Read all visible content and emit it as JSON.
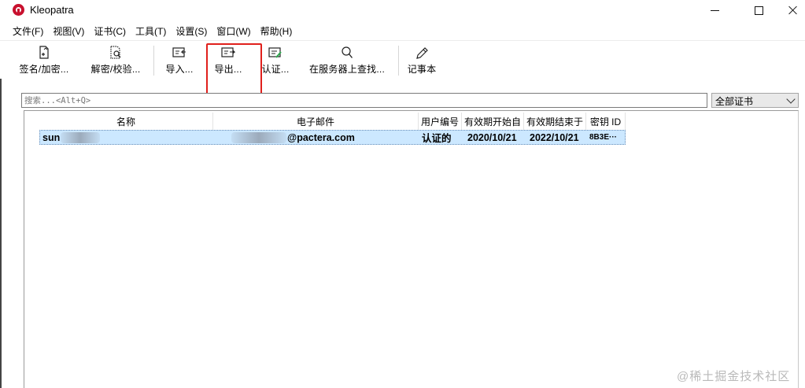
{
  "window": {
    "title": "Kleopatra"
  },
  "menu": [
    "文件(F)",
    "视图(V)",
    "证书(C)",
    "工具(T)",
    "设置(S)",
    "窗口(W)",
    "帮助(H)"
  ],
  "toolbar": {
    "sign_encrypt": "签名/加密...",
    "decrypt_verify": "解密/校验...",
    "import": "导入...",
    "export": "导出...",
    "certify": "认证...",
    "lookup_server": "在服务器上查找...",
    "notepad": "记事本"
  },
  "search": {
    "placeholder": "搜索...<Alt+Q>",
    "value": ""
  },
  "filter": {
    "selected": "全部证书"
  },
  "table": {
    "headers": [
      "名称",
      "电子邮件",
      "用户编号",
      "有效期开始自",
      "有效期结束于",
      "密钥 ID"
    ],
    "rows": [
      {
        "name": "sun",
        "email": "@pactera.com",
        "user_id": "认证的",
        "valid_from": "2020/10/21",
        "valid_until": "2022/10/21",
        "key_id": "8B3E···"
      }
    ]
  },
  "watermark": "@稀土掘金技术社区",
  "colors": {
    "selection": "#cce8ff",
    "highlight_box": "#e0201c",
    "app_icon": "#c8102e"
  }
}
